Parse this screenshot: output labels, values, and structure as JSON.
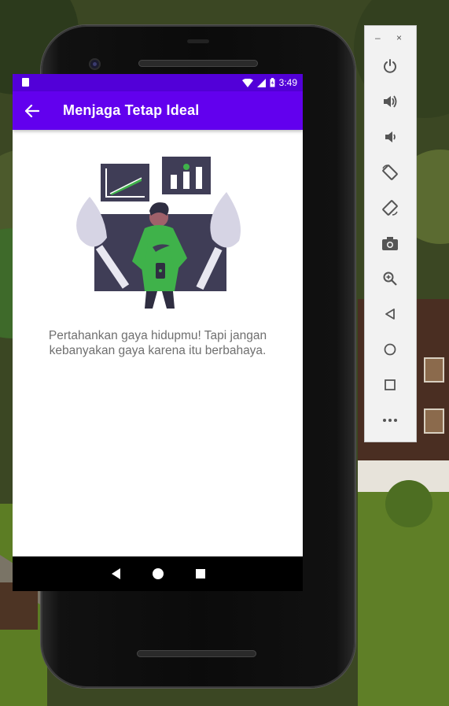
{
  "status_bar": {
    "time": "3:49"
  },
  "app_bar": {
    "title": "Menjaga Tetap Ideal"
  },
  "content": {
    "description": "Pertahankan gaya hidupmu! Tapi jangan kebanyakan gaya karena itu berbahaya."
  },
  "nav_bar": {
    "buttons": [
      "back",
      "home",
      "recents"
    ]
  },
  "emulator_panel": {
    "minimize_label": "–",
    "close_label": "×",
    "buttons": [
      "power",
      "volume-up",
      "volume-down",
      "rotate-left",
      "rotate-right",
      "screenshot",
      "zoom",
      "back",
      "home",
      "overview",
      "more"
    ]
  },
  "colors": {
    "status_bar": "#5200d8",
    "app_bar": "#6200ee",
    "accent_green": "#3fb24a",
    "text_secondary": "#6f6f6f"
  }
}
